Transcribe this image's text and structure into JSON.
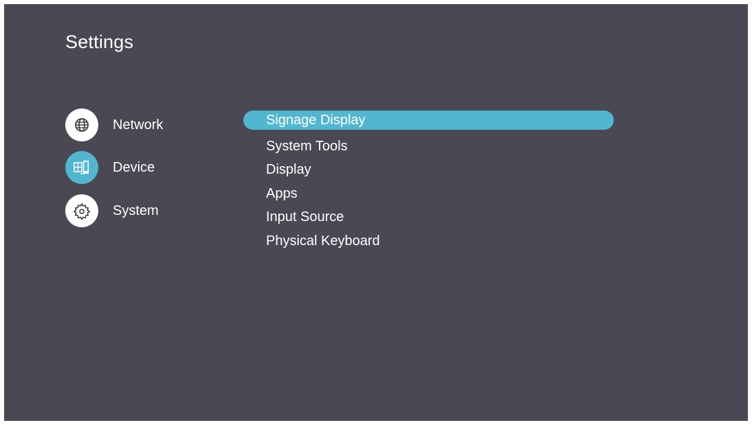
{
  "header": {
    "title": "Settings"
  },
  "categories": [
    {
      "label": "Network",
      "icon": "globe-icon",
      "active": false
    },
    {
      "label": "Device",
      "icon": "device-displays-icon",
      "active": true
    },
    {
      "label": "System",
      "icon": "gear-icon",
      "active": false
    }
  ],
  "menu": {
    "items": [
      {
        "label": "Signage Display",
        "selected": true
      },
      {
        "label": "System Tools"
      },
      {
        "label": "Display"
      },
      {
        "label": "Apps"
      },
      {
        "label": "Input Source"
      },
      {
        "label": "Physical Keyboard"
      }
    ]
  },
  "colors": {
    "background": "#4a4852",
    "accent": "#52b6d0",
    "text": "#ffffff"
  }
}
